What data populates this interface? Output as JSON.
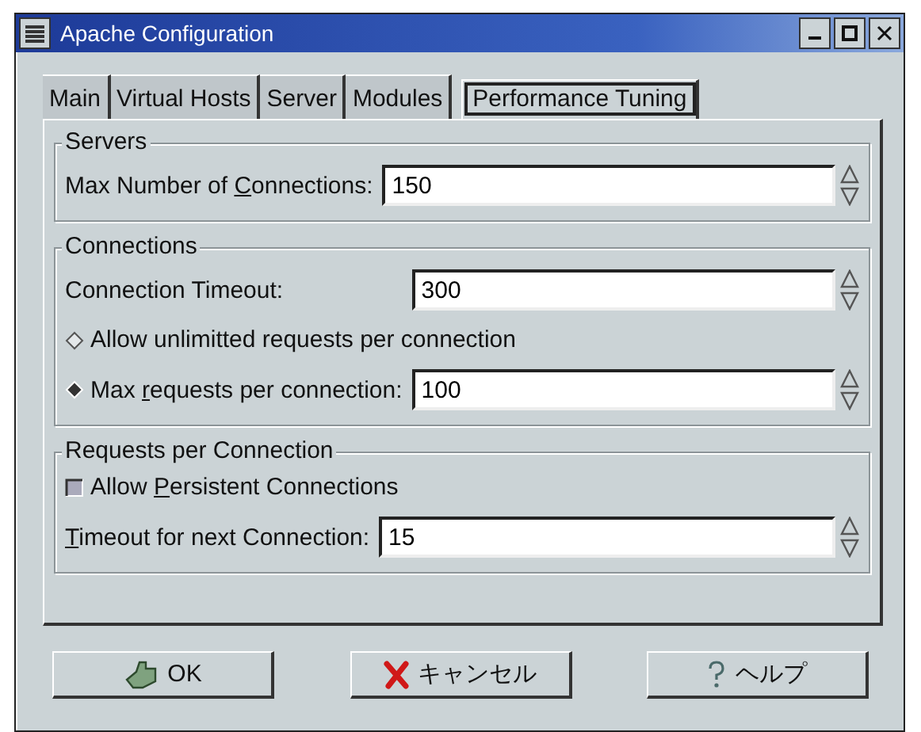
{
  "window": {
    "title": "Apache Configuration"
  },
  "tabs": [
    {
      "label": "Main",
      "selected": false
    },
    {
      "label": "Virtual Hosts",
      "selected": false
    },
    {
      "label": "Server",
      "selected": false
    },
    {
      "label": "Modules",
      "selected": false
    },
    {
      "label": "Performance Tuning",
      "selected": true
    }
  ],
  "groups": [
    {
      "title": "Servers",
      "rows": [
        {
          "kind": "spin",
          "label": [
            {
              "text": "Max Number of ",
              "underline": false
            },
            {
              "text": "C",
              "underline": true
            },
            {
              "text": "onnections:",
              "underline": false
            }
          ],
          "value": "150"
        }
      ]
    },
    {
      "title": "Connections",
      "rows": [
        {
          "kind": "spin",
          "label": [
            {
              "text": "Connection Timeout:",
              "underline": false
            }
          ],
          "value": "300"
        },
        {
          "kind": "radio",
          "label": [
            {
              "text": "Allow unlimitted requests per connection",
              "underline": false
            }
          ],
          "selected": false
        },
        {
          "kind": "radio-spin",
          "label": [
            {
              "text": "Max ",
              "underline": false
            },
            {
              "text": "r",
              "underline": true
            },
            {
              "text": "equests per connection:",
              "underline": false
            }
          ],
          "selected": true,
          "value": "100"
        }
      ]
    },
    {
      "title": "Requests per Connection",
      "rows": [
        {
          "kind": "check",
          "label": [
            {
              "text": "Allow ",
              "underline": false
            },
            {
              "text": "P",
              "underline": true
            },
            {
              "text": "ersistent Connections",
              "underline": false
            }
          ],
          "checked": false
        },
        {
          "kind": "spin",
          "label": [
            {
              "text": "T",
              "underline": true
            },
            {
              "text": "imeout for next Connection:",
              "underline": false
            }
          ],
          "value": "15"
        }
      ]
    }
  ],
  "buttons": [
    {
      "kind": "ok",
      "label": "OK"
    },
    {
      "kind": "cancel",
      "label": "キャンセル"
    },
    {
      "kind": "help",
      "label": "ヘルプ"
    }
  ]
}
